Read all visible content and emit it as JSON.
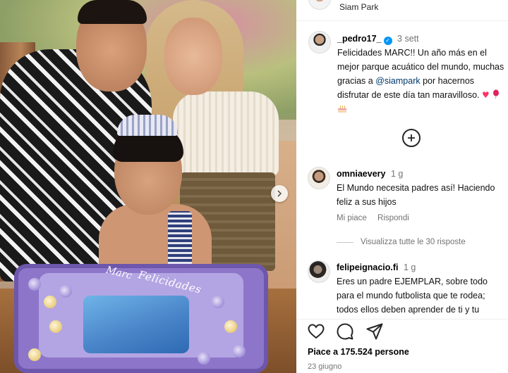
{
  "header": {
    "location": "Siam Park"
  },
  "post": {
    "cake_text": "Felicidades",
    "cake_name": "Marc"
  },
  "caption": {
    "username": "_pedro17_",
    "time": "3 sett",
    "text_before_mention": "Felicidades MARC!! Un año más en el mejor parque acuático del mundo, muchas gracias a ",
    "mention": "@siampark",
    "text_after_mention": " por hacernos disfrutar de este día tan maravilloso.",
    "emojis": [
      "heart-emoji",
      "balloon-emoji",
      "cake-emoji"
    ]
  },
  "comments": [
    {
      "username": "omniaevery",
      "time": "1 g",
      "text": "El Mundo necesita padres así! Haciendo feliz a sus hijos",
      "like_label": "Mi piace",
      "reply_label": "Rispondi",
      "view_replies": "Visualizza tutte le 30 risposte"
    },
    {
      "username": "felipeignacio.fi",
      "time": "1 g",
      "text": "Eres un padre EJEMPLAR, sobre todo para el mundo futbolista que te rodea; todos ellos deben aprender de ti y tu"
    }
  ],
  "actions": {
    "icons": [
      "heart-icon",
      "comment-icon",
      "share-icon"
    ],
    "likes": "Piace a 175.524 persone",
    "date": "23 giugno"
  },
  "colors": {
    "mention": "#00376b",
    "verified": "#0095f6",
    "muted": "#737373"
  }
}
